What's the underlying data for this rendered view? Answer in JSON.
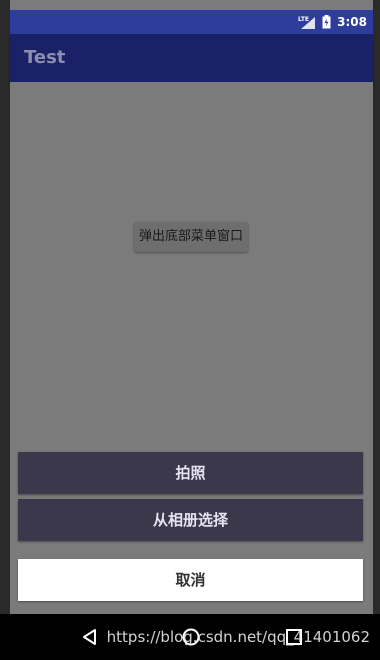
{
  "status_bar": {
    "network_label": "LTE",
    "time": "3:08",
    "icons": [
      "lte-signal-icon",
      "battery-charging-icon"
    ]
  },
  "app_bar": {
    "title": "Test"
  },
  "main": {
    "popup_button_label": "弹出底部菜单窗口"
  },
  "bottom_sheet": {
    "take_photo_label": "拍照",
    "choose_from_album_label": "从相册选择",
    "cancel_label": "取消"
  },
  "nav_bar": {
    "icons": [
      "back-icon",
      "home-icon",
      "recents-icon"
    ]
  },
  "watermark": {
    "text": "https://blog.csdn.net/qq_41401062"
  },
  "colors": {
    "status_bar": "#2e3d9c",
    "app_bar": "#1a2167",
    "dim_background": "#7b7b7b",
    "sheet_dark": "#3b384b",
    "sheet_light": "#ffffff"
  }
}
